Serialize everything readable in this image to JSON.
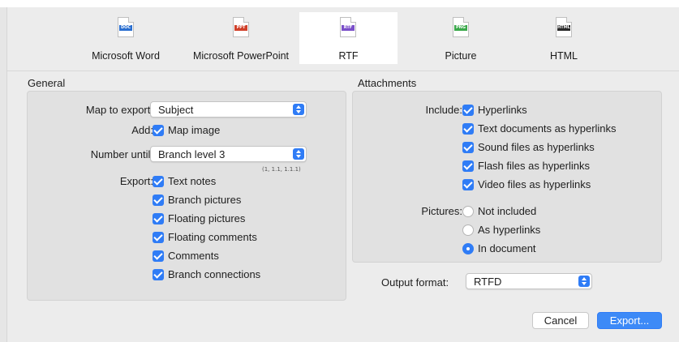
{
  "tabs": [
    {
      "badge": "DOC",
      "label": "Microsoft Word",
      "color": "#2b6fd0",
      "selected": false
    },
    {
      "badge": "PPT",
      "label": "Microsoft PowerPoint",
      "color": "#d0412b",
      "selected": false
    },
    {
      "badge": "RTF",
      "label": "RTF",
      "color": "#7a4fc9",
      "selected": true
    },
    {
      "badge": "PNG",
      "label": "Picture",
      "color": "#3aa84a",
      "selected": false
    },
    {
      "badge": "HTML",
      "label": "HTML",
      "color": "#2a2a2a",
      "selected": false
    }
  ],
  "general": {
    "title": "General",
    "map_label": "Map to export:",
    "map_value": "Subject",
    "add_label": "Add:",
    "add_map_image": "Map image",
    "number_label": "Number until:",
    "number_value": "Branch level 3",
    "number_hint": "(1, 1.1, 1.1.1)",
    "export_label": "Export:",
    "export_items": [
      "Text notes",
      "Branch pictures",
      "Floating pictures",
      "Floating comments",
      "Comments",
      "Branch connections"
    ]
  },
  "attachments": {
    "title": "Attachments",
    "include_label": "Include:",
    "include_items": [
      "Hyperlinks",
      "Text documents as hyperlinks",
      "Sound files as hyperlinks",
      "Flash files as hyperlinks",
      "Video files as hyperlinks"
    ],
    "pictures_label": "Pictures:",
    "pictures_options": [
      "Not included",
      "As hyperlinks",
      "In document"
    ],
    "pictures_selected": "In document"
  },
  "output": {
    "label": "Output format:",
    "value": "RTFD"
  },
  "buttons": {
    "cancel": "Cancel",
    "export": "Export..."
  },
  "colors": {
    "accent": "#2f7cf6"
  }
}
